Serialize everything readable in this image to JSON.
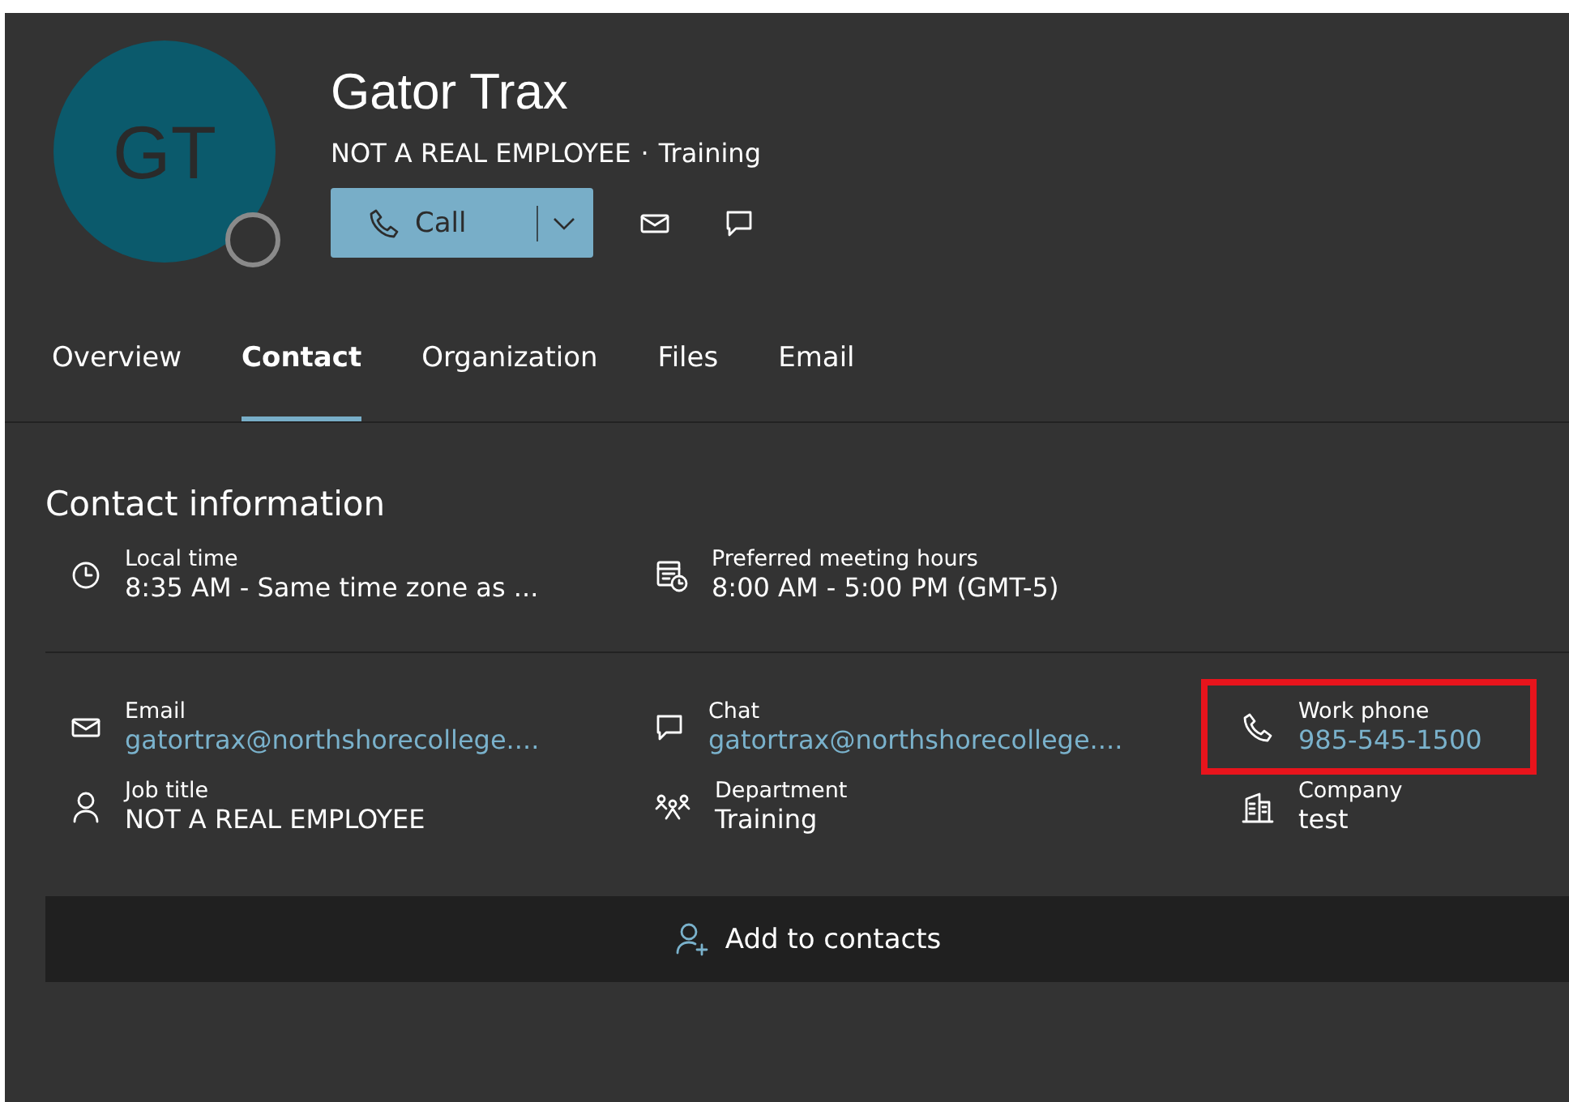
{
  "profile": {
    "initials": "GT",
    "name": "Gator Trax",
    "title": "NOT A REAL EMPLOYEE",
    "separator": "·",
    "department": "Training",
    "online": false
  },
  "actions": {
    "call_label": "Call"
  },
  "tabs": [
    {
      "label": "Overview",
      "selected": false
    },
    {
      "label": "Contact",
      "selected": true
    },
    {
      "label": "Organization",
      "selected": false
    },
    {
      "label": "Files",
      "selected": false
    },
    {
      "label": "Email",
      "selected": false
    }
  ],
  "section_title": "Contact information",
  "time_fields": [
    {
      "kind": "clock",
      "label": "Local time",
      "value": "8:35 AM - Same time zone as ...",
      "link": false,
      "highlighted": false
    },
    {
      "kind": "calendar",
      "label": "Preferred meeting hours",
      "value": "8:00 AM - 5:00 PM (GMT-5)",
      "link": false,
      "highlighted": false
    }
  ],
  "fields": [
    {
      "kind": "mail",
      "label": "Email",
      "value": "gatortrax@northshorecollege....",
      "link": true,
      "highlighted": false
    },
    {
      "kind": "chat",
      "label": "Chat",
      "value": "gatortrax@northshorecollege....",
      "link": true,
      "highlighted": false
    },
    {
      "kind": "phone",
      "label": "Work phone",
      "value": "985-545-1500",
      "link": true,
      "highlighted": true
    },
    {
      "kind": "person",
      "label": "Job title",
      "value": "NOT A REAL EMPLOYEE",
      "link": false,
      "highlighted": false
    },
    {
      "kind": "people",
      "label": "Department",
      "value": "Training",
      "link": false,
      "highlighted": false
    },
    {
      "kind": "building",
      "label": "Company",
      "value": "test",
      "link": false,
      "highlighted": false
    }
  ],
  "add_button": {
    "label": "Add to contacts"
  }
}
